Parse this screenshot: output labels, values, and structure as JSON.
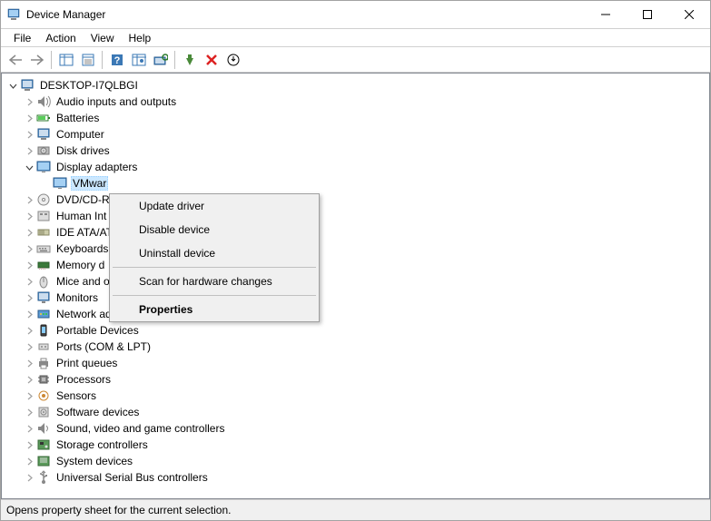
{
  "title": "Device Manager",
  "menu": {
    "file": "File",
    "action": "Action",
    "view": "View",
    "help": "Help"
  },
  "tree": {
    "root": "DESKTOP-I7QLBGI",
    "categories": [
      {
        "label": "Audio inputs and outputs",
        "icon": "speaker"
      },
      {
        "label": "Batteries",
        "icon": "battery"
      },
      {
        "label": "Computer",
        "icon": "computer"
      },
      {
        "label": "Disk drives",
        "icon": "disk"
      },
      {
        "label": "Display adapters",
        "icon": "display",
        "expanded": true
      },
      {
        "label": "DVD/CD-R",
        "icon": "dvd"
      },
      {
        "label": "Human Int",
        "icon": "hid"
      },
      {
        "label": "IDE ATA/AT",
        "icon": "ide"
      },
      {
        "label": "Keyboards",
        "icon": "keyboard"
      },
      {
        "label": "Memory d",
        "icon": "memory"
      },
      {
        "label": "Mice and o",
        "icon": "mouse"
      },
      {
        "label": "Monitors",
        "icon": "monitor"
      },
      {
        "label": "Network adapters",
        "icon": "network"
      },
      {
        "label": "Portable Devices",
        "icon": "portable"
      },
      {
        "label": "Ports (COM & LPT)",
        "icon": "ports"
      },
      {
        "label": "Print queues",
        "icon": "printer"
      },
      {
        "label": "Processors",
        "icon": "cpu"
      },
      {
        "label": "Sensors",
        "icon": "sensor"
      },
      {
        "label": "Software devices",
        "icon": "software"
      },
      {
        "label": "Sound, video and game controllers",
        "icon": "sound"
      },
      {
        "label": "Storage controllers",
        "icon": "storage"
      },
      {
        "label": "System devices",
        "icon": "system"
      },
      {
        "label": "Universal Serial Bus controllers",
        "icon": "usb"
      }
    ],
    "selected_device": "VMwar"
  },
  "context_menu": {
    "update": "Update driver",
    "disable": "Disable device",
    "uninstall": "Uninstall device",
    "scan": "Scan for hardware changes",
    "properties": "Properties"
  },
  "status": "Opens property sheet for the current selection."
}
